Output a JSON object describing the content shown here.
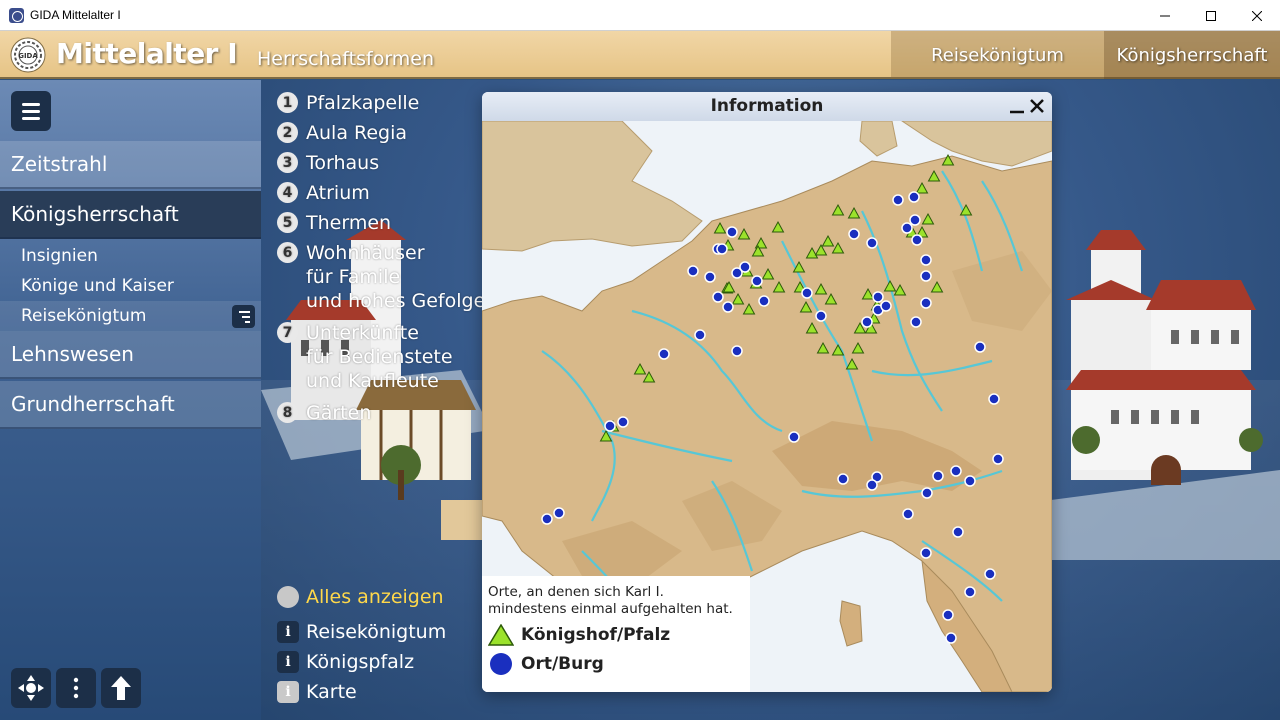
{
  "window": {
    "title": "GIDA Mittelalter I"
  },
  "header": {
    "app_name": "Mittelalter I",
    "section": "Herrschaftsformen",
    "tabs": [
      "Reisekönigtum",
      "Königsherrschaft"
    ]
  },
  "sidebar": {
    "items": [
      "Zeitstrahl",
      "Königsherrschaft",
      "Lehnswesen",
      "Grundherrschaft"
    ],
    "subitems": [
      "Insignien",
      "Könige und Kaiser",
      "Reisekönigtum"
    ]
  },
  "poi": [
    {
      "num": "1",
      "lines": [
        "Pfalzkapelle"
      ]
    },
    {
      "num": "2",
      "lines": [
        "Aula Regia"
      ]
    },
    {
      "num": "3",
      "lines": [
        "Torhaus"
      ]
    },
    {
      "num": "4",
      "lines": [
        "Atrium"
      ]
    },
    {
      "num": "5",
      "lines": [
        "Thermen"
      ]
    },
    {
      "num": "6",
      "lines": [
        "Wohnhäuser",
        "für Famile",
        "und hohes Gefolge"
      ]
    },
    {
      "num": "7",
      "lines": [
        "Unterkünfte",
        "für Bedienstete",
        "und Kaufleute"
      ]
    },
    {
      "num": "8",
      "lines": [
        "Gärten"
      ]
    }
  ],
  "actions": {
    "show_all": "Alles anzeigen",
    "info_items": [
      "Reisekönigtum",
      "Königspfalz",
      "Karte"
    ],
    "info_glyph": "i"
  },
  "dialog": {
    "title": "Information",
    "legend_caption": "Orte, an denen sich Karl I. mindestens einmal aufgehalten hat.",
    "legend_items": [
      {
        "label": "Königshof/Pfalz",
        "color": "#9be22b"
      },
      {
        "label": "Ort/Burg",
        "color": "#1a2fbf"
      }
    ]
  },
  "colors": {
    "header": "#e8c78a",
    "sidebar": "#3e6191",
    "map_land": "#d8b98a",
    "map_sea": "#eef3f8",
    "river": "#57c7d6"
  }
}
